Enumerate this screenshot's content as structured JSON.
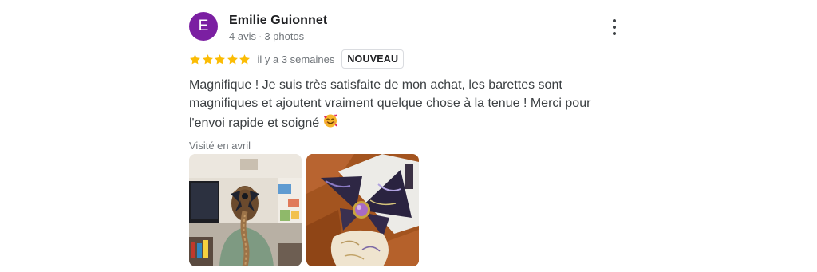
{
  "author": {
    "initial": "E",
    "name": "Emilie Guionnet",
    "reviews": "4 avis",
    "separator": "·",
    "photos": "3 photos",
    "avatar_color": "#7b1fa2"
  },
  "menu": {
    "icon": "more-vert-icon"
  },
  "rating": {
    "stars": 5,
    "star_color": "#fbbc04",
    "date": "il y a 3 semaines",
    "badge": "NOUVEAU"
  },
  "review": {
    "text": "Magnifique ! Je suis très satisfaite de mon achat, les barettes sont magnifiques et ajoutent vraiment quelque chose à la tenue ! Merci pour l'envoi rapide et soigné",
    "emoji": "smiling-face-with-hearts"
  },
  "visited": "Visité en avril",
  "photos": [
    {
      "description_icon": "photo-hair-bow"
    },
    {
      "description_icon": "photo-scarves"
    }
  ]
}
